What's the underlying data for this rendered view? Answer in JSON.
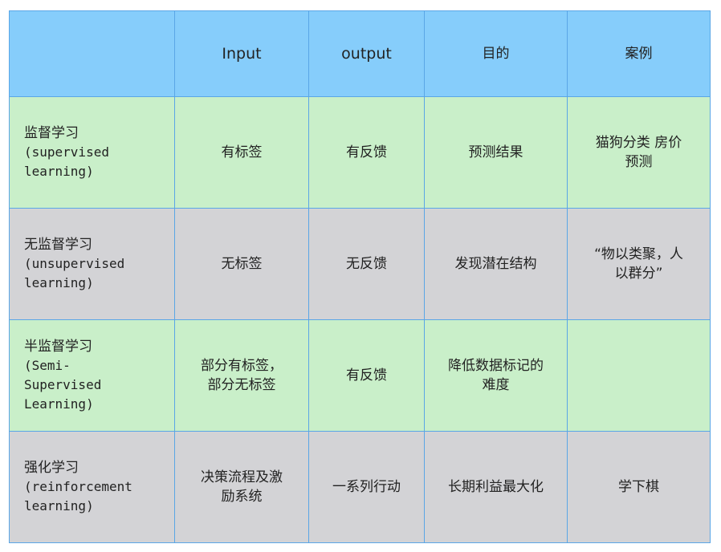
{
  "header": [
    "",
    "Input",
    "output",
    "目的",
    "案例"
  ],
  "rows": [
    {
      "name_cn": "监督学习",
      "name_en": [
        "(supervised",
        "learning)"
      ],
      "input": "有标签",
      "output": "有反馈",
      "purpose": "预测结果",
      "example": [
        "猫狗分类 房价",
        "预测"
      ]
    },
    {
      "name_cn": "无监督学习",
      "name_en": [
        "(unsupervised",
        "learning)"
      ],
      "input": "无标签",
      "output": "无反馈",
      "purpose": "发现潜在结构",
      "example": [
        "“物以类聚，人",
        "以群分”"
      ]
    },
    {
      "name_cn": "半监督学习",
      "name_en": [
        "(Semi-",
        "Supervised",
        "Learning)"
      ],
      "input": [
        "部分有标签，",
        "部分无标签"
      ],
      "output": "有反馈",
      "purpose": [
        "降低数据标记的",
        "难度"
      ],
      "example": [
        ""
      ]
    },
    {
      "name_cn": "强化学习",
      "name_en": [
        "(reinforcement",
        "learning)"
      ],
      "input": [
        "决策流程及激",
        "励系统"
      ],
      "output": "一系列行动",
      "purpose": "长期利益最大化",
      "example": [
        "学下棋"
      ]
    }
  ]
}
